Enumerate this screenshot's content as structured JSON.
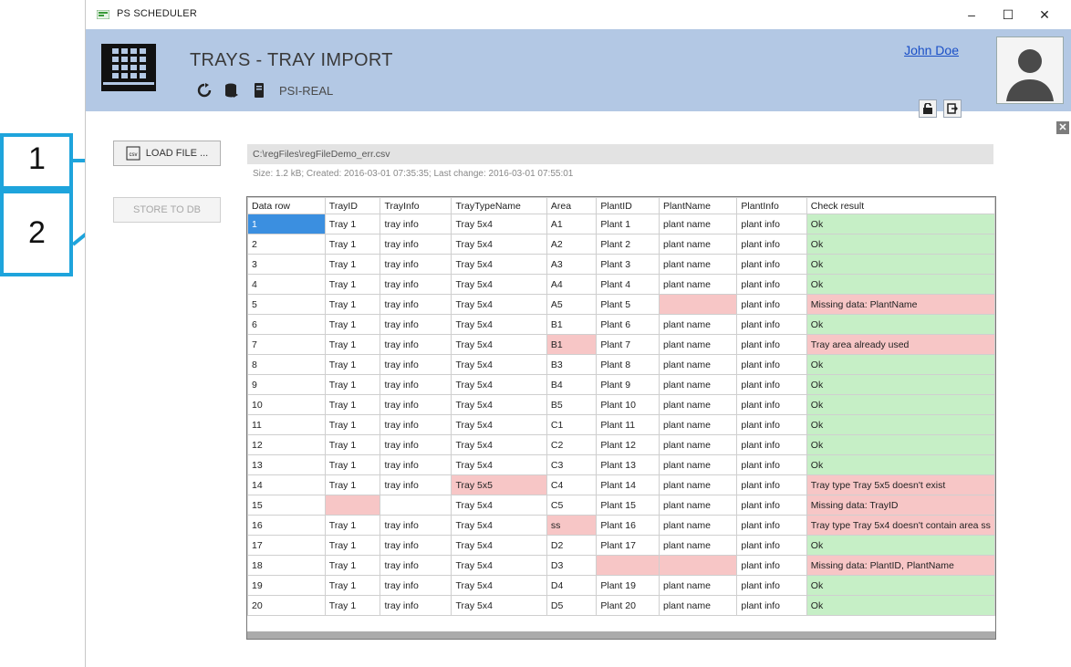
{
  "window": {
    "title": "PS SCHEDULER",
    "minimize": "–",
    "maximize": "☐",
    "close": "✕"
  },
  "header": {
    "title": "TRAYS - TRAY IMPORT",
    "db_name": "PSI-REAL",
    "user_name": "John Doe",
    "accent_color": "#b3c8e4"
  },
  "actions": {
    "load_file_label": "LOAD FILE ...",
    "load_file_icon": "csv",
    "store_db_label": "STORE TO DB"
  },
  "file": {
    "path": "C:\\regFiles\\regFileDemo_err.csv",
    "info": "Size: 1.2 kB;  Created: 2016-03-01  07:35:35;  Last change: 2016-03-01  07:55:01"
  },
  "callouts": [
    "1",
    "2"
  ],
  "panel_close": "✕",
  "table": {
    "columns": [
      "Data row",
      "TrayID",
      "TrayInfo",
      "TrayTypeName",
      "Area",
      "PlantID",
      "PlantName",
      "PlantInfo",
      "Check result"
    ],
    "rows": [
      {
        "cells": [
          "1",
          "Tray 1",
          "tray info",
          "Tray 5x4",
          "A1",
          "Plant 1",
          "plant name",
          "plant info",
          "Ok"
        ],
        "status": "ok",
        "errcols": []
      },
      {
        "cells": [
          "2",
          "Tray 1",
          "tray info",
          "Tray 5x4",
          "A2",
          "Plant 2",
          "plant name",
          "plant info",
          "Ok"
        ],
        "status": "ok",
        "errcols": []
      },
      {
        "cells": [
          "3",
          "Tray 1",
          "tray info",
          "Tray 5x4",
          "A3",
          "Plant 3",
          "plant name",
          "plant info",
          "Ok"
        ],
        "status": "ok",
        "errcols": []
      },
      {
        "cells": [
          "4",
          "Tray 1",
          "tray info",
          "Tray 5x4",
          "A4",
          "Plant 4",
          "plant name",
          "plant info",
          "Ok"
        ],
        "status": "ok",
        "errcols": []
      },
      {
        "cells": [
          "5",
          "Tray 1",
          "tray info",
          "Tray 5x4",
          "A5",
          "Plant 5",
          "",
          "plant info",
          "Missing data: PlantName"
        ],
        "status": "err",
        "errcols": [
          6
        ]
      },
      {
        "cells": [
          "6",
          "Tray 1",
          "tray info",
          "Tray 5x4",
          "B1",
          "Plant 6",
          "plant name",
          "plant info",
          "Ok"
        ],
        "status": "ok",
        "errcols": []
      },
      {
        "cells": [
          "7",
          "Tray 1",
          "tray info",
          "Tray 5x4",
          "B1",
          "Plant 7",
          "plant name",
          "plant info",
          "Tray area already used"
        ],
        "status": "err",
        "errcols": [
          4
        ]
      },
      {
        "cells": [
          "8",
          "Tray 1",
          "tray info",
          "Tray 5x4",
          "B3",
          "Plant 8",
          "plant name",
          "plant info",
          "Ok"
        ],
        "status": "ok",
        "errcols": []
      },
      {
        "cells": [
          "9",
          "Tray 1",
          "tray info",
          "Tray 5x4",
          "B4",
          "Plant 9",
          "plant name",
          "plant info",
          "Ok"
        ],
        "status": "ok",
        "errcols": []
      },
      {
        "cells": [
          "10",
          "Tray 1",
          "tray info",
          "Tray 5x4",
          "B5",
          "Plant 10",
          "plant name",
          "plant info",
          "Ok"
        ],
        "status": "ok",
        "errcols": []
      },
      {
        "cells": [
          "11",
          "Tray 1",
          "tray info",
          "Tray 5x4",
          "C1",
          "Plant 11",
          "plant name",
          "plant info",
          "Ok"
        ],
        "status": "ok",
        "errcols": []
      },
      {
        "cells": [
          "12",
          "Tray 1",
          "tray info",
          "Tray 5x4",
          "C2",
          "Plant 12",
          "plant name",
          "plant info",
          "Ok"
        ],
        "status": "ok",
        "errcols": []
      },
      {
        "cells": [
          "13",
          "Tray 1",
          "tray info",
          "Tray 5x4",
          "C3",
          "Plant 13",
          "plant name",
          "plant info",
          "Ok"
        ],
        "status": "ok",
        "errcols": []
      },
      {
        "cells": [
          "14",
          "Tray 1",
          "tray info",
          "Tray 5x5",
          "C4",
          "Plant 14",
          "plant name",
          "plant info",
          "Tray type Tray 5x5 doesn't exist"
        ],
        "status": "err",
        "errcols": [
          3
        ]
      },
      {
        "cells": [
          "15",
          "",
          "",
          "Tray 5x4",
          "C5",
          "Plant 15",
          "plant name",
          "plant info",
          "Missing data: TrayID"
        ],
        "status": "err",
        "errcols": [
          1
        ]
      },
      {
        "cells": [
          "16",
          "Tray 1",
          "tray info",
          "Tray 5x4",
          "ss",
          "Plant 16",
          "plant name",
          "plant info",
          "Tray type Tray 5x4 doesn't contain area ss"
        ],
        "status": "err",
        "errcols": [
          4
        ]
      },
      {
        "cells": [
          "17",
          "Tray 1",
          "tray info",
          "Tray 5x4",
          "D2",
          "Plant 17",
          "plant name",
          "plant info",
          "Ok"
        ],
        "status": "ok",
        "errcols": []
      },
      {
        "cells": [
          "18",
          "Tray 1",
          "tray info",
          "Tray 5x4",
          "D3",
          "",
          "",
          "plant info",
          "Missing data: PlantID, PlantName"
        ],
        "status": "err",
        "errcols": [
          5,
          6
        ]
      },
      {
        "cells": [
          "19",
          "Tray 1",
          "tray info",
          "Tray 5x4",
          "D4",
          "Plant 19",
          "plant name",
          "plant info",
          "Ok"
        ],
        "status": "ok",
        "errcols": []
      },
      {
        "cells": [
          "20",
          "Tray 1",
          "tray info",
          "Tray 5x4",
          "D5",
          "Plant 20",
          "plant name",
          "plant info",
          "Ok"
        ],
        "status": "ok",
        "errcols": []
      }
    ]
  }
}
